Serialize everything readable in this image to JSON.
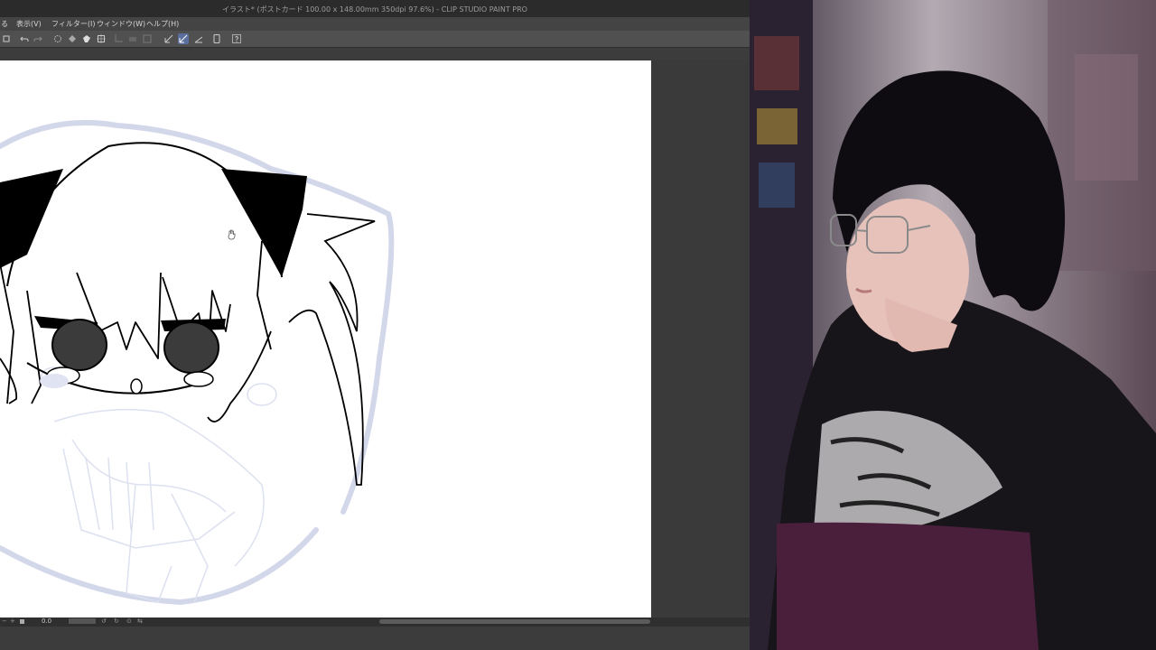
{
  "window": {
    "title": "イラスト* (ポストカード 100.00 x 148.00mm 350dpi 97.6%) - CLIP STUDIO PAINT PRO"
  },
  "menu": {
    "items": [
      "る",
      "表示(V)",
      "フィルター(I)",
      "ウィンドウ(W)",
      "ヘルプ(H)"
    ]
  },
  "status": {
    "zoom": "0.0"
  },
  "colors": {
    "ui_dark": "#2b2b2b",
    "ui_mid": "#505050",
    "canvas_bg": "#3a3a3a",
    "paper": "#ffffff",
    "active_tool": "#5b6f9e",
    "sketch": "#c9cfe4"
  }
}
